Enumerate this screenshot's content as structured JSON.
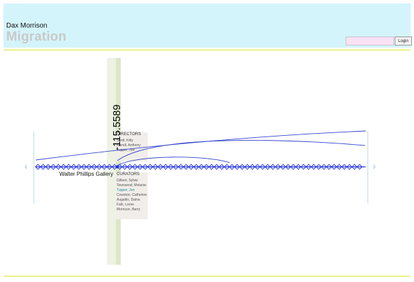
{
  "header": {
    "artist_name": "Dax Morrison",
    "project_title": "Migration"
  },
  "login": {
    "input_value": "",
    "button_label": "Login"
  },
  "timeline": {
    "coordinate_label": "-115.5589",
    "venue_label": "Walter Phillips Gallery"
  },
  "directors": {
    "heading": "DIRECTORS",
    "names": [
      "Scott, Kitty",
      "Kiendl, Anthony",
      "Tupper, Jon"
    ]
  },
  "curators": {
    "heading": "CURATORS",
    "names": [
      "Gilbert, Sylvie",
      "Townsend, Melanie",
      "Tupper, Jon",
      "Cowston, Catherine",
      "Augaitis, Daina",
      "Falk, Lorne",
      "Morrison, Barry"
    ]
  },
  "colors": {
    "header_bg": "#d4f4fb",
    "project_title": "#c9c9c9",
    "rule": "#d8ea2e",
    "timeline_blue": "#2233dd",
    "arc_blue": "#3344cc",
    "panel_bg": "#f1eeea",
    "timeline_band": "#e4ecd5",
    "highlight_name": "#1d8e8e"
  },
  "icons": {
    "left_arrow": "chevron-left-icon",
    "right_arrow": "chevron-right-icon"
  }
}
